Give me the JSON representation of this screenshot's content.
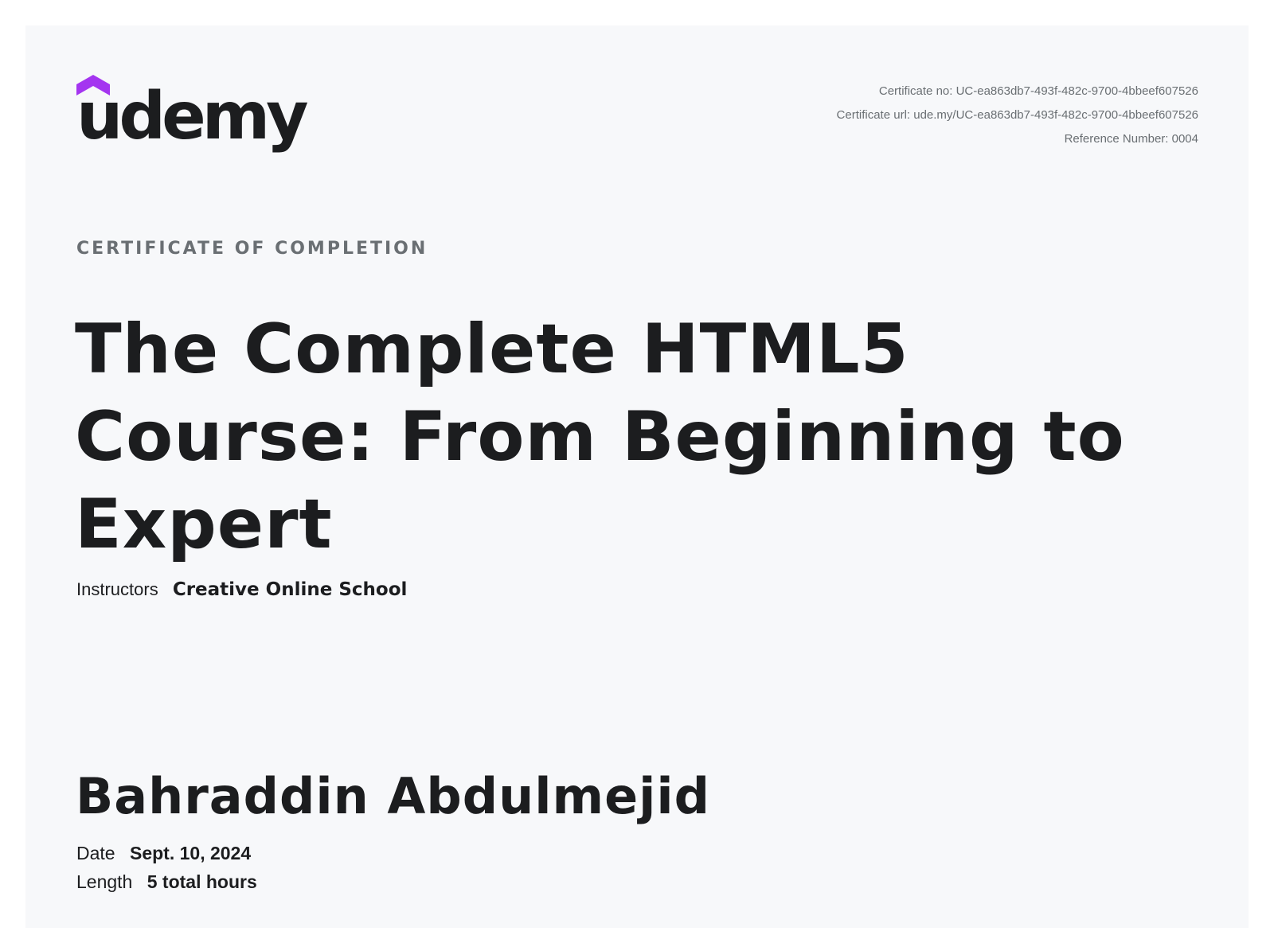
{
  "logo": {
    "icon": "udemy-logo-icon",
    "text": "udemy",
    "accent_color": "#a435f0"
  },
  "meta": {
    "certificate_no": "Certificate no: UC-ea863db7-493f-482c-9700-4bbeef607526",
    "certificate_url": "Certificate url: ude.my/UC-ea863db7-493f-482c-9700-4bbeef607526",
    "reference_number": "Reference Number: 0004"
  },
  "certificate": {
    "subtitle": "CERTIFICATE OF COMPLETION",
    "course_title": "The Complete HTML5 Course: From Beginning to Expert",
    "instructors_label": "Instructors",
    "instructors_value": "Creative Online School",
    "student_name": "Bahraddin Abdulmejid",
    "date_label": "Date",
    "date_value": "Sept. 10, 2024",
    "length_label": "Length",
    "length_value": "5 total hours"
  },
  "colors": {
    "background": "#f7f8fa",
    "text_primary": "#1c1d1f",
    "text_secondary": "#6a6f73"
  }
}
